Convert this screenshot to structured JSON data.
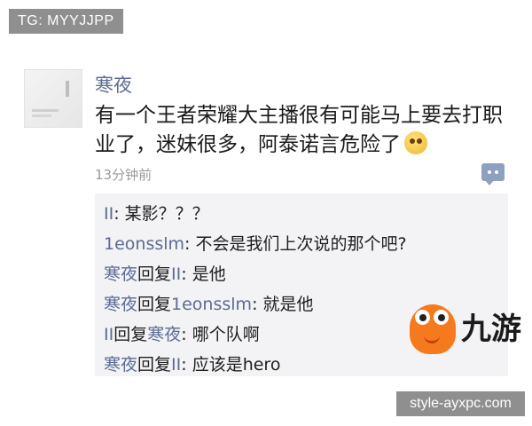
{
  "watermark_top": "TG: MYYJJPP",
  "watermark_bottom": "style-ayxpc.com",
  "post": {
    "author": "寒夜",
    "text": "有一个王者荣耀大主播很有可能马上要去打职业了，迷妹很多，阿泰诺言危险了",
    "time": "13分钟前"
  },
  "comments": [
    {
      "from": "II",
      "to": "",
      "reply_word": "",
      "text": "某影？？？"
    },
    {
      "from": "1eonsslm",
      "to": "",
      "reply_word": "",
      "text": "不会是我们上次说的那个吧?"
    },
    {
      "from": "寒夜",
      "to": "II",
      "reply_word": "回复",
      "text": "是他"
    },
    {
      "from": "寒夜",
      "to": "1eonsslm",
      "reply_word": "回复",
      "text": "就是他"
    },
    {
      "from": "II",
      "to": "寒夜",
      "reply_word": "回复",
      "text": "哪个队啊"
    },
    {
      "from": "寒夜",
      "to": "II",
      "reply_word": "回复",
      "text": "应该是hero"
    }
  ],
  "logo_text": "九游",
  "icons": {
    "emoji": "smile-emoji-icon",
    "comment": "comment-bubble-icon",
    "mascot": "jiuyou-mascot-icon"
  },
  "colors": {
    "nickname": "#5b6b92",
    "comment_bg": "#f3f3f5",
    "watermark_bg": "#8f8f8f",
    "logo_orange": "#f57a1e"
  }
}
